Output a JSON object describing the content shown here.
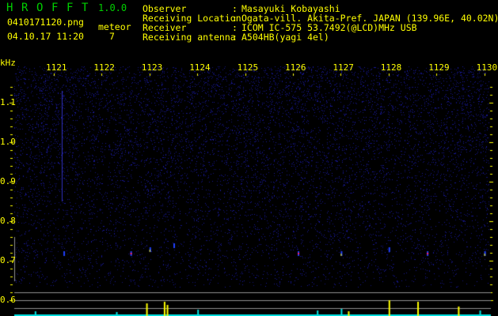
{
  "app": {
    "name_letters": [
      "H",
      "R",
      "O",
      "F",
      "F",
      "T"
    ],
    "version": "1.0.0"
  },
  "file": {
    "name": "0410171120.png",
    "datetime": "04.10.17 11:20"
  },
  "meteor": {
    "label": "meteor",
    "count": "7"
  },
  "station": [
    {
      "label": "Observer",
      "sep": ":",
      "value": "Masayuki Kobayashi"
    },
    {
      "label": "Receiving Location",
      "sep": ":",
      "value": "Ogata-vill. Akita-Pref. JAPAN (139.96E, 40.02N)"
    },
    {
      "label": "Receiver",
      "sep": ":",
      "value": "ICOM IC-575 53.7492(@LCD)MHz USB"
    },
    {
      "label": "Receiving antenna",
      "sep": ":",
      "value": "A504HB(yagi 4el)"
    }
  ],
  "axes": {
    "unit": "kHz",
    "x_ticks": [
      "1121",
      "1122",
      "1123",
      "1124",
      "1125",
      "1126",
      "1127",
      "1128",
      "1129",
      "1130"
    ],
    "y_ticks": [
      "1.1",
      "1.0",
      "0.9",
      "0.8",
      "0.7",
      "0.6"
    ]
  },
  "colors": {
    "text": "#ffff00",
    "title": "#00d000",
    "noise": "#1a1a9a",
    "level": "#00e0e0",
    "peak": "#ffff00",
    "grid": "#909090"
  },
  "detections_kHz": [
    {
      "x": 1121.2,
      "y": 0.72
    },
    {
      "x": 1122.6,
      "y": 0.72
    },
    {
      "x": 1123.0,
      "y": 0.73
    },
    {
      "x": 1123.5,
      "y": 0.74
    },
    {
      "x": 1126.1,
      "y": 0.72
    },
    {
      "x": 1127.0,
      "y": 0.72
    },
    {
      "x": 1128.0,
      "y": 0.73
    },
    {
      "x": 1128.8,
      "y": 0.72
    },
    {
      "x": 1130.0,
      "y": 0.72
    }
  ],
  "peaks_kHz": [
    {
      "x": 1122.93,
      "level": 0.8,
      "color": "peak"
    },
    {
      "x": 1123.3,
      "level": 0.9,
      "color": "peak"
    },
    {
      "x": 1123.36,
      "level": 0.7,
      "color": "peak"
    },
    {
      "x": 1127.15,
      "level": 0.3,
      "color": "peak"
    },
    {
      "x": 1128.0,
      "level": 1.0,
      "color": "peak"
    },
    {
      "x": 1128.6,
      "level": 0.9,
      "color": "peak"
    },
    {
      "x": 1129.45,
      "level": 0.6,
      "color": "peak"
    },
    {
      "x": 1120.6,
      "level": 0.3,
      "color": "level"
    },
    {
      "x": 1122.3,
      "level": 0.25,
      "color": "level"
    },
    {
      "x": 1124.0,
      "level": 0.4,
      "color": "level"
    },
    {
      "x": 1126.5,
      "level": 0.35,
      "color": "level"
    },
    {
      "x": 1127.0,
      "level": 0.45,
      "color": "level"
    },
    {
      "x": 1129.9,
      "level": 0.35,
      "color": "level"
    }
  ]
}
